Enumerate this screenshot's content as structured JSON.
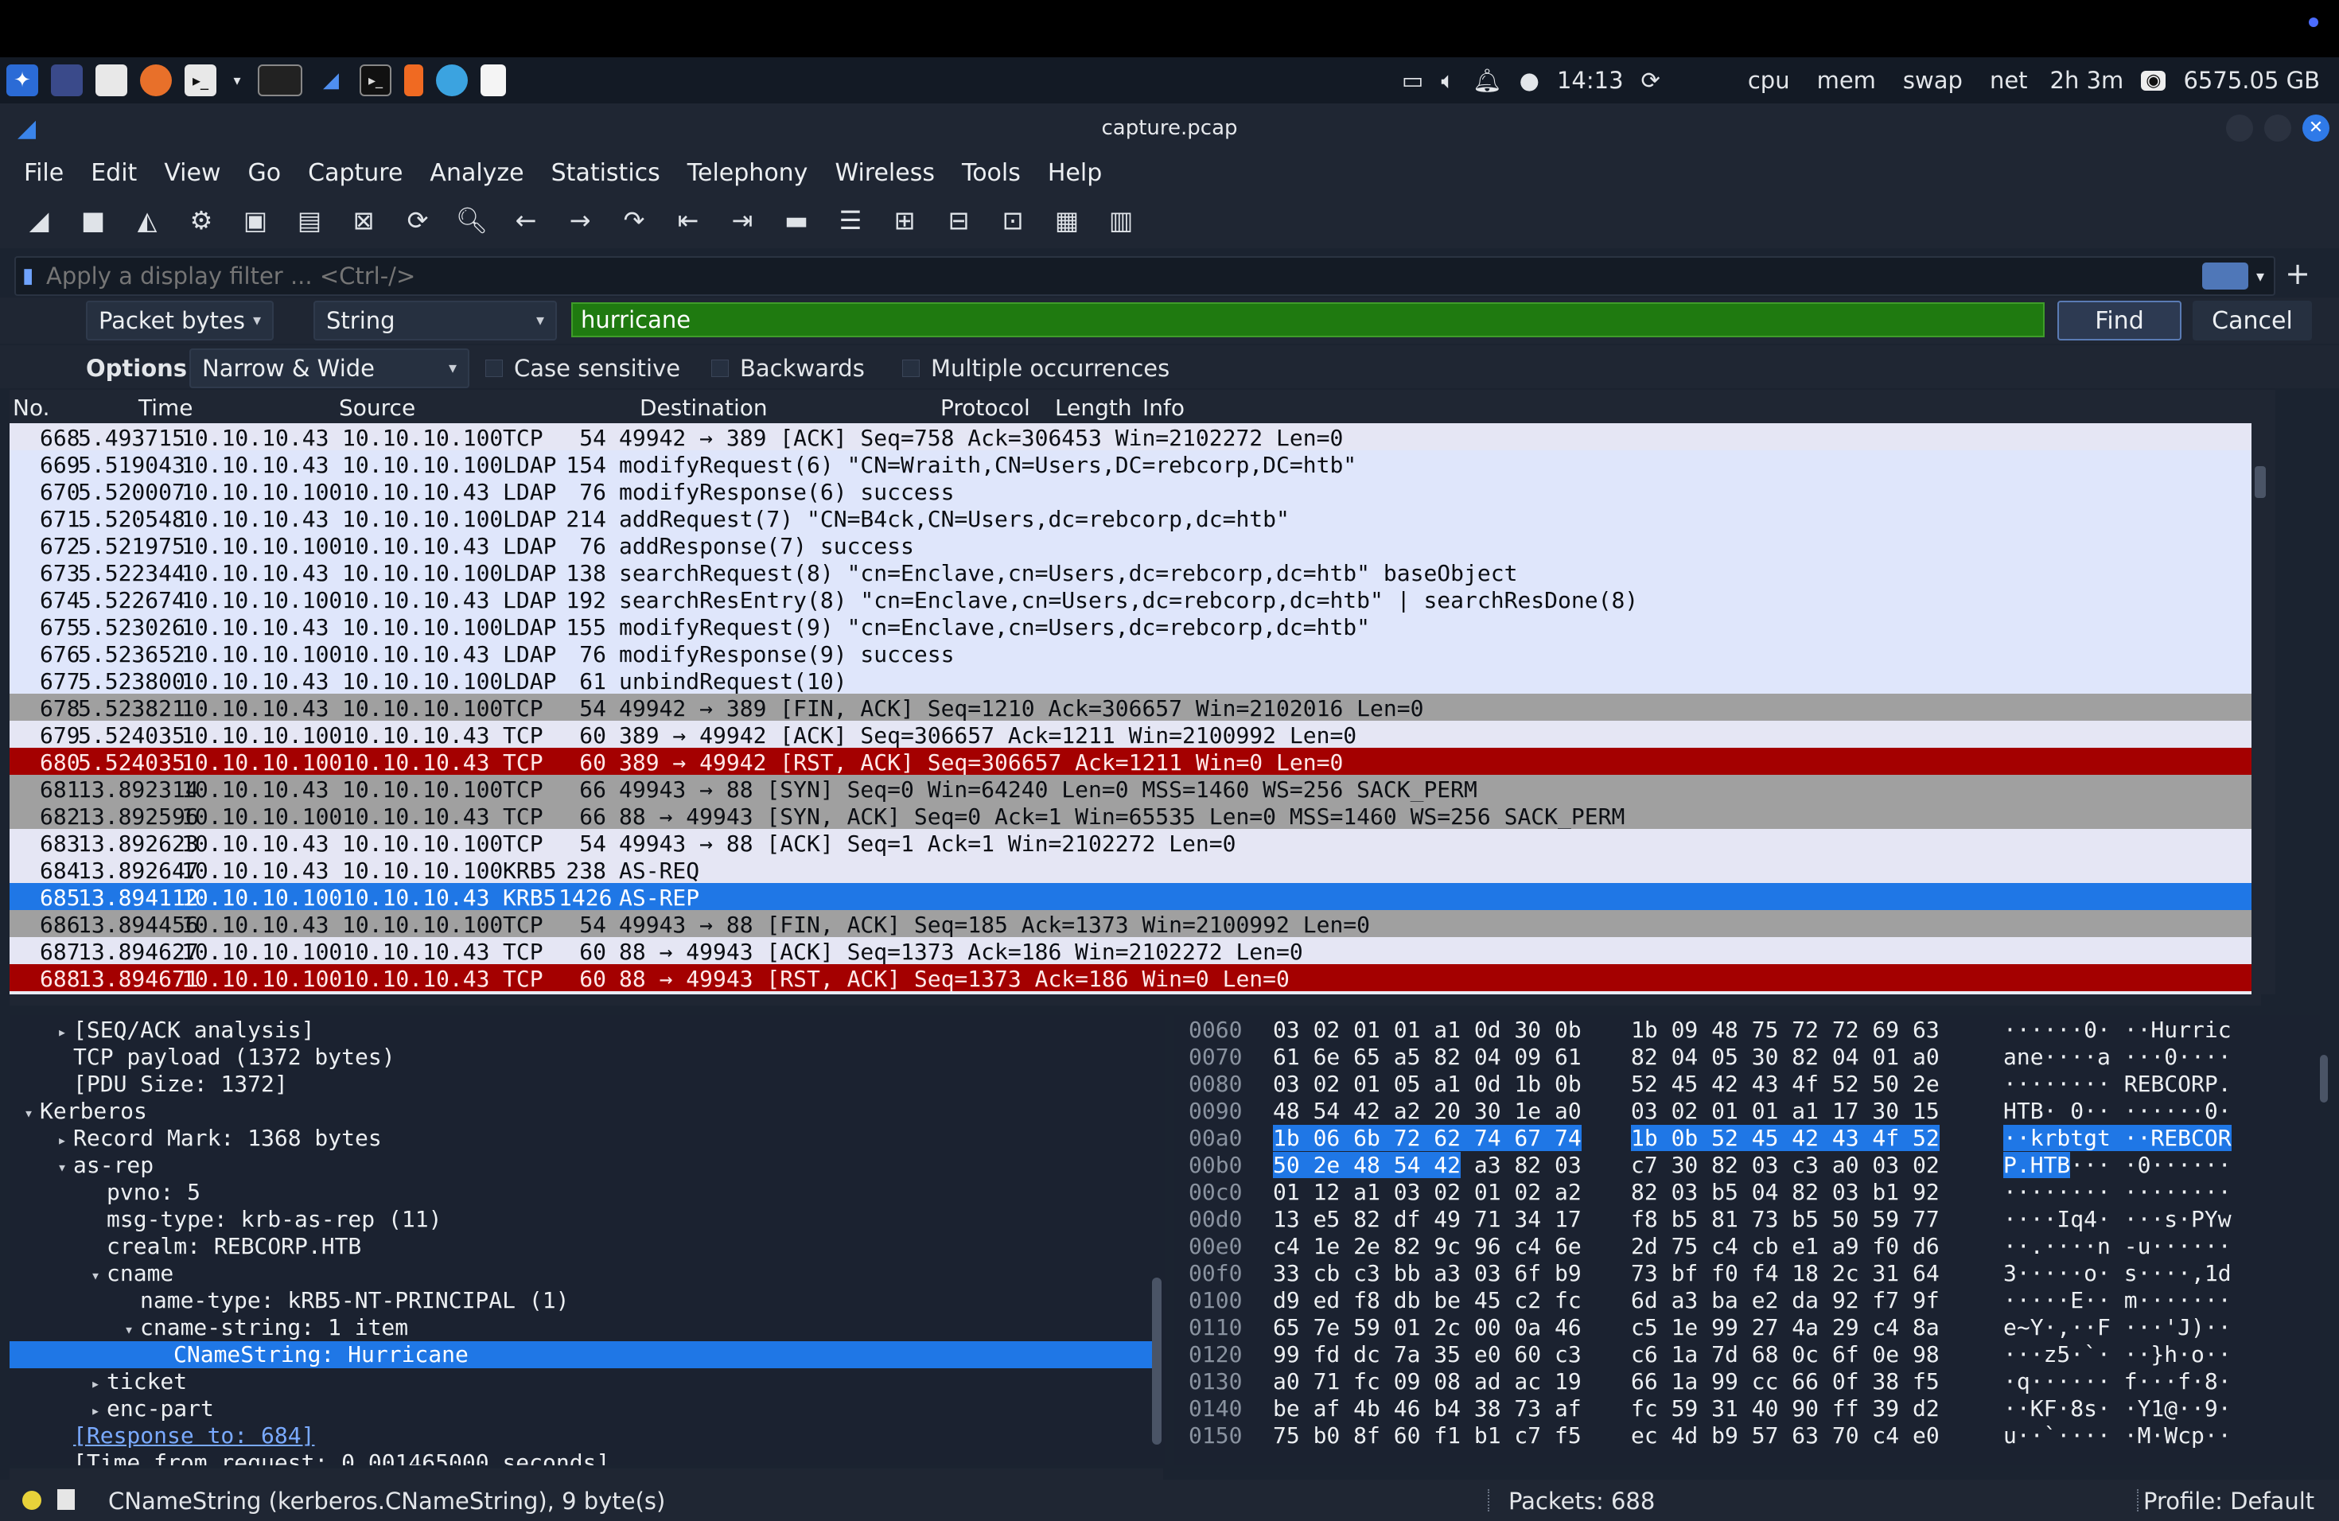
{
  "taskbar": {
    "clock": "14:13",
    "indicators": [
      "cpu",
      "mem",
      "swap",
      "net"
    ],
    "uptime": "2h 3m",
    "disk": "6575.05 GB"
  },
  "window": {
    "title": "capture.pcap"
  },
  "menu": [
    "File",
    "Edit",
    "View",
    "Go",
    "Capture",
    "Analyze",
    "Statistics",
    "Telephony",
    "Wireless",
    "Tools",
    "Help"
  ],
  "filter": {
    "placeholder": "Apply a display filter ... <Ctrl-/>"
  },
  "search": {
    "search_in": "Packet bytes",
    "search_type": "String",
    "value": "hurricane",
    "find_label": "Find",
    "cancel_label": "Cancel",
    "options_label": "Options:",
    "char_width": "Narrow & Wide",
    "case_sensitive": "Case sensitive",
    "backwards": "Backwards",
    "multiple": "Multiple occurrences"
  },
  "packet_list": {
    "columns": [
      "No.",
      "Time",
      "Source",
      "Destination",
      "Protocol",
      "Length",
      "Info"
    ],
    "rows": [
      {
        "no": "668",
        "time": "5.493715",
        "src": "10.10.10.43",
        "dst": "10.10.10.100",
        "proto": "TCP",
        "len": "54",
        "info": "49942 → 389 [ACK] Seq=758 Ack=306453 Win=2102272 Len=0",
        "style": "tcp"
      },
      {
        "no": "669",
        "time": "5.519043",
        "src": "10.10.10.43",
        "dst": "10.10.10.100",
        "proto": "LDAP",
        "len": "154",
        "info": "modifyRequest(6) \"CN=Wraith,CN=Users,DC=rebcorp,DC=htb\"",
        "style": "ldap"
      },
      {
        "no": "670",
        "time": "5.520007",
        "src": "10.10.10.100",
        "dst": "10.10.10.43",
        "proto": "LDAP",
        "len": "76",
        "info": "modifyResponse(6) success",
        "style": "ldap"
      },
      {
        "no": "671",
        "time": "5.520548",
        "src": "10.10.10.43",
        "dst": "10.10.10.100",
        "proto": "LDAP",
        "len": "214",
        "info": "addRequest(7) \"CN=B4ck,CN=Users,dc=rebcorp,dc=htb\"",
        "style": "ldap"
      },
      {
        "no": "672",
        "time": "5.521975",
        "src": "10.10.10.100",
        "dst": "10.10.10.43",
        "proto": "LDAP",
        "len": "76",
        "info": "addResponse(7) success",
        "style": "ldap"
      },
      {
        "no": "673",
        "time": "5.522344",
        "src": "10.10.10.43",
        "dst": "10.10.10.100",
        "proto": "LDAP",
        "len": "138",
        "info": "searchRequest(8) \"cn=Enclave,cn=Users,dc=rebcorp,dc=htb\" baseObject",
        "style": "ldap"
      },
      {
        "no": "674",
        "time": "5.522674",
        "src": "10.10.10.100",
        "dst": "10.10.10.43",
        "proto": "LDAP",
        "len": "192",
        "info": "searchResEntry(8) \"cn=Enclave,cn=Users,dc=rebcorp,dc=htb\"  | searchResDone(8)",
        "style": "ldap"
      },
      {
        "no": "675",
        "time": "5.523026",
        "src": "10.10.10.43",
        "dst": "10.10.10.100",
        "proto": "LDAP",
        "len": "155",
        "info": "modifyRequest(9) \"cn=Enclave,cn=Users,dc=rebcorp,dc=htb\"",
        "style": "ldap"
      },
      {
        "no": "676",
        "time": "5.523652",
        "src": "10.10.10.100",
        "dst": "10.10.10.43",
        "proto": "LDAP",
        "len": "76",
        "info": "modifyResponse(9) success",
        "style": "ldap"
      },
      {
        "no": "677",
        "time": "5.523800",
        "src": "10.10.10.43",
        "dst": "10.10.10.100",
        "proto": "LDAP",
        "len": "61",
        "info": "unbindRequest(10)",
        "style": "ldap"
      },
      {
        "no": "678",
        "time": "5.523821",
        "src": "10.10.10.43",
        "dst": "10.10.10.100",
        "proto": "TCP",
        "len": "54",
        "info": "49942 → 389 [FIN, ACK] Seq=1210 Ack=306657 Win=2102016 Len=0",
        "style": "fin"
      },
      {
        "no": "679",
        "time": "5.524035",
        "src": "10.10.10.100",
        "dst": "10.10.10.43",
        "proto": "TCP",
        "len": "60",
        "info": "389 → 49942 [ACK] Seq=306657 Ack=1211 Win=2100992 Len=0",
        "style": "tcp"
      },
      {
        "no": "680",
        "time": "5.524035",
        "src": "10.10.10.100",
        "dst": "10.10.10.43",
        "proto": "TCP",
        "len": "60",
        "info": "389 → 49942 [RST, ACK] Seq=306657 Ack=1211 Win=0 Len=0",
        "style": "rst"
      },
      {
        "no": "681",
        "time": "13.892314",
        "src": "10.10.10.43",
        "dst": "10.10.10.100",
        "proto": "TCP",
        "len": "66",
        "info": "49943 → 88 [SYN] Seq=0 Win=64240 Len=0 MSS=1460 WS=256 SACK_PERM",
        "style": "gray"
      },
      {
        "no": "682",
        "time": "13.892596",
        "src": "10.10.10.100",
        "dst": "10.10.10.43",
        "proto": "TCP",
        "len": "66",
        "info": "88 → 49943 [SYN, ACK] Seq=0 Ack=1 Win=65535 Len=0 MSS=1460 WS=256 SACK_PERM",
        "style": "gray"
      },
      {
        "no": "683",
        "time": "13.892623",
        "src": "10.10.10.43",
        "dst": "10.10.10.100",
        "proto": "TCP",
        "len": "54",
        "info": "49943 → 88 [ACK] Seq=1 Ack=1 Win=2102272 Len=0",
        "style": "tcp"
      },
      {
        "no": "684",
        "time": "13.892647",
        "src": "10.10.10.43",
        "dst": "10.10.10.100",
        "proto": "KRB5",
        "len": "238",
        "info": "AS-REQ",
        "style": "tcp"
      },
      {
        "no": "685",
        "time": "13.894112",
        "src": "10.10.10.100",
        "dst": "10.10.10.43",
        "proto": "KRB5",
        "len": "1426",
        "info": "AS-REP",
        "style": "sel"
      },
      {
        "no": "686",
        "time": "13.894456",
        "src": "10.10.10.43",
        "dst": "10.10.10.100",
        "proto": "TCP",
        "len": "54",
        "info": "49943 → 88 [FIN, ACK] Seq=185 Ack=1373 Win=2100992 Len=0",
        "style": "fin"
      },
      {
        "no": "687",
        "time": "13.894627",
        "src": "10.10.10.100",
        "dst": "10.10.10.43",
        "proto": "TCP",
        "len": "60",
        "info": "88 → 49943 [ACK] Seq=1373 Ack=186 Win=2102272 Len=0",
        "style": "tcp"
      },
      {
        "no": "688",
        "time": "13.894671",
        "src": "10.10.10.100",
        "dst": "10.10.10.43",
        "proto": "TCP",
        "len": "60",
        "info": "88 → 49943 [RST, ACK] Seq=1373 Ack=186 Win=0 Len=0",
        "style": "rst"
      }
    ]
  },
  "details": [
    {
      "indent": 1,
      "tri": "▸",
      "text": "[SEQ/ACK analysis]"
    },
    {
      "indent": 1,
      "tri": "",
      "text": "TCP payload (1372 bytes)"
    },
    {
      "indent": 1,
      "tri": "",
      "text": "[PDU Size: 1372]"
    },
    {
      "indent": 0,
      "tri": "▾",
      "text": "Kerberos"
    },
    {
      "indent": 1,
      "tri": "▸",
      "text": "Record Mark: 1368 bytes"
    },
    {
      "indent": 1,
      "tri": "▾",
      "text": "as-rep"
    },
    {
      "indent": 2,
      "tri": "",
      "text": "pvno: 5"
    },
    {
      "indent": 2,
      "tri": "",
      "text": "msg-type: krb-as-rep (11)"
    },
    {
      "indent": 2,
      "tri": "",
      "text": "crealm: REBCORP.HTB"
    },
    {
      "indent": 2,
      "tri": "▾",
      "text": "cname"
    },
    {
      "indent": 3,
      "tri": "",
      "text": "name-type: kRB5-NT-PRINCIPAL (1)"
    },
    {
      "indent": 3,
      "tri": "▾",
      "text": "cname-string: 1 item"
    },
    {
      "indent": 4,
      "tri": "",
      "text": "CNameString: Hurricane",
      "selected": true
    },
    {
      "indent": 2,
      "tri": "▸",
      "text": "ticket"
    },
    {
      "indent": 2,
      "tri": "▸",
      "text": "enc-part"
    },
    {
      "indent": 1,
      "tri": "",
      "text": "[Response to: 684]",
      "link": true
    },
    {
      "indent": 1,
      "tri": "",
      "text": "[Time from request: 0.001465000 seconds]"
    }
  ],
  "bytes": [
    {
      "off": "0060",
      "h1": "03 02 01 01 a1 0d 30 0b",
      "h2": "1b 09 48 75 72 72 69 63",
      "asc": "······0· ··Hurric"
    },
    {
      "off": "0070",
      "h1": "61 6e 65 a5 82 04 09 61",
      "h2": "82 04 05 30 82 04 01 a0",
      "asc": "ane····a ···0····"
    },
    {
      "off": "0080",
      "h1": "03 02 01 05 a1 0d 1b 0b",
      "h2": "52 45 42 43 4f 52 50 2e",
      "asc": "········ REBCORP."
    },
    {
      "off": "0090",
      "h1": "48 54 42 a2 20 30 1e a0",
      "h2": "03 02 01 01 a1 17 30 15",
      "asc": "HTB· 0·· ······0·"
    },
    {
      "off": "00a0",
      "h1": "1b 06 6b 72 62 74 67 74",
      "h2": "1b 0b 52 45 42 43 4f 52",
      "asc": "··krbtgt ··REBCOR",
      "hl": "full"
    },
    {
      "off": "00b0",
      "h1": "50 2e 48 54 42 a3 82 03",
      "h2": "c7 30 82 03 c3 a0 03 02",
      "asc": "P.HTB··· ·0······",
      "hl": "partial"
    },
    {
      "off": "00c0",
      "h1": "01 12 a1 03 02 01 02 a2",
      "h2": "82 03 b5 04 82 03 b1 92",
      "asc": "········ ········"
    },
    {
      "off": "00d0",
      "h1": "13 e5 82 df 49 71 34 17",
      "h2": "f8 b5 81 73 b5 50 59 77",
      "asc": "····Iq4· ···s·PYw"
    },
    {
      "off": "00e0",
      "h1": "c4 1e 2e 82 9c 96 c4 6e",
      "h2": "2d 75 c4 cb e1 a9 f0 d6",
      "asc": "··.····n -u······"
    },
    {
      "off": "00f0",
      "h1": "33 cb c3 bb a3 03 6f b9",
      "h2": "73 bf f0 f4 18 2c 31 64",
      "asc": "3·····o· s····,1d"
    },
    {
      "off": "0100",
      "h1": "d9 ed f8 db be 45 c2 fc",
      "h2": "6d a3 ba e2 da 92 f7 9f",
      "asc": "·····E·· m·······"
    },
    {
      "off": "0110",
      "h1": "65 7e 59 01 2c 00 0a 46",
      "h2": "c5 1e 99 27 4a 29 c4 8a",
      "asc": "e~Y·,··F ···'J)··"
    },
    {
      "off": "0120",
      "h1": "99 fd dc 7a 35 e0 60 c3",
      "h2": "c6 1a 7d 68 0c 6f 0e 98",
      "asc": "···z5·`· ··}h·o··"
    },
    {
      "off": "0130",
      "h1": "a0 71 fc 09 08 ad ac 19",
      "h2": "66 1a 99 cc 66 0f 38 f5",
      "asc": "·q······ f···f·8·"
    },
    {
      "off": "0140",
      "h1": "be af 4b 46 b4 38 73 af",
      "h2": "fc 59 31 40 90 ff 39 d2",
      "asc": "··KF·8s· ·Y1@··9·"
    },
    {
      "off": "0150",
      "h1": "75 b0 8f 60 f1 b1 c7 f5",
      "h2": "ec 4d b9 57 63 70 c4 e0",
      "asc": "u··`···· ·M·Wcp··"
    }
  ],
  "status": {
    "field": "CNameString (kerberos.CNameString), 9 byte(s)",
    "packets": "Packets: 688",
    "profile": "Profile: Default"
  },
  "colors": {
    "selected": "#1f77e6",
    "rst": "#a40000",
    "search_ok": "#1f7a10"
  }
}
